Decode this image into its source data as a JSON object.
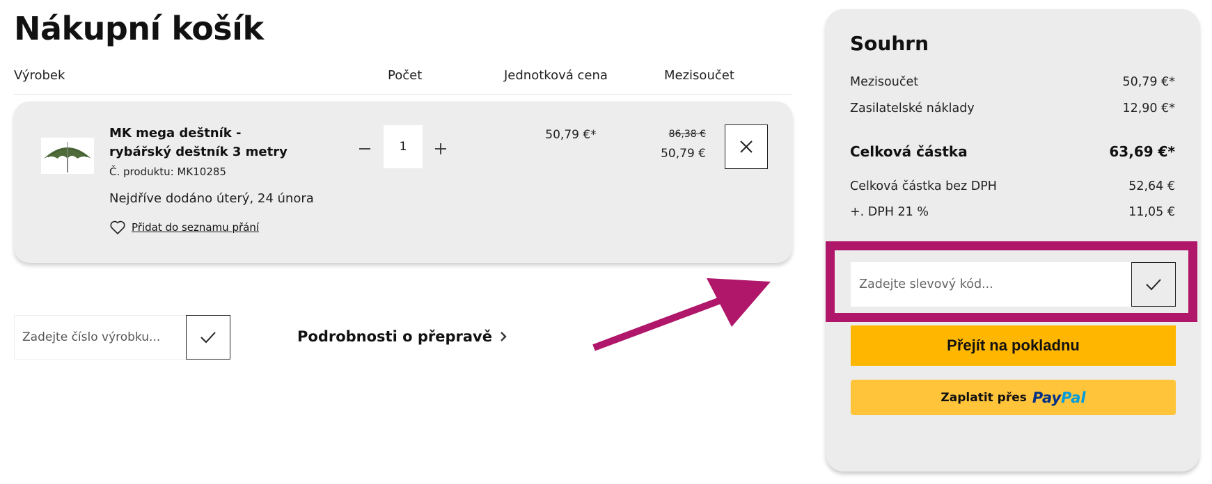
{
  "cart": {
    "title": "Nákupní košík",
    "columns": {
      "product": "Výrobek",
      "quantity": "Počet",
      "unit_price": "Jednotková cena",
      "subtotal": "Mezisoučet"
    },
    "item": {
      "name": "MK mega deštník - rybářský deštník 3 metry",
      "sku": "Č. produktu: MK10285",
      "delivery": "Nejdříve dodáno úterý, 24 února",
      "wishlist_label": "Přidat do seznamu přání",
      "quantity": "1",
      "unit_price": "50,79 €*",
      "old_price": "86,38 €",
      "subtotal": "50,79 €"
    },
    "sku_input_placeholder": "Zadejte číslo výrobku...",
    "shipping_link": "Podrobnosti o přepravě"
  },
  "summary": {
    "title": "Souhrn",
    "rows": [
      {
        "label": "Mezisoučet",
        "value": "50,79 €*"
      },
      {
        "label": "Zasilatelské náklady",
        "value": "12,90 €*"
      }
    ],
    "total_label": "Celková částka",
    "total_value": "63,69 €*",
    "tax_rows": [
      {
        "label": "Celková částka bez DPH",
        "value": "52,64 €"
      },
      {
        "label": "+. DPH 21 %",
        "value": "11,05 €"
      }
    ],
    "discount_placeholder": "Zadejte slevový kód...",
    "checkout_label": "Přejít na pokladnu",
    "paypal_prefix": "Zaplatit přes",
    "paypal_logo_part1": "Pay",
    "paypal_logo_part2": "Pal"
  },
  "colors": {
    "annotation": "#b0176a",
    "checkout": "#ffb600",
    "paypal_button": "#ffc43a"
  }
}
